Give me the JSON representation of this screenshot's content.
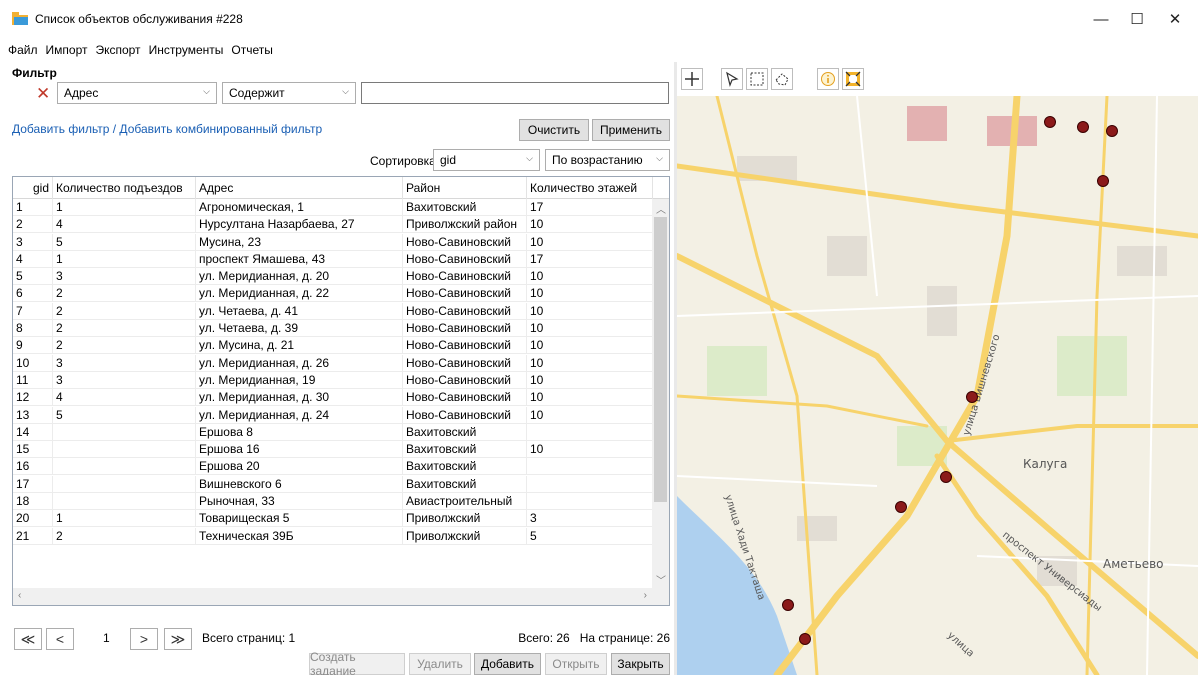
{
  "window": {
    "title": "Список объектов обслуживания #228",
    "minimize": "—",
    "maximize": "☐",
    "close": "✕"
  },
  "menu": [
    "Файл",
    "Импорт",
    "Экспорт",
    "Инструменты",
    "Отчеты"
  ],
  "filter": {
    "title": "Фильтр",
    "field": "Адрес",
    "operator": "Содержит",
    "value": "",
    "add_link": "Добавить фильтр / Добавить комбинированный фильтр",
    "clear": "Очистить",
    "apply": "Применить"
  },
  "sort": {
    "label": "Сортировка",
    "field": "gid",
    "order": "По возрастанию"
  },
  "table": {
    "columns": [
      "gid",
      "Количество подъездов",
      "Адрес",
      "Район",
      "Количество этажей"
    ],
    "rows": [
      [
        "1",
        "1",
        "Агрономическая, 1",
        "Вахитовский",
        "17"
      ],
      [
        "2",
        "4",
        "Нурсултана Назарбаева, 27",
        "Приволжский район",
        "10"
      ],
      [
        "3",
        "5",
        "Мусина, 23",
        "Ново-Савиновский",
        "10"
      ],
      [
        "4",
        "1",
        "проспект Ямашева, 43",
        "Ново-Савиновский",
        "17"
      ],
      [
        "5",
        "3",
        "ул. Меридианная, д. 20",
        "Ново-Савиновский",
        "10"
      ],
      [
        "6",
        "2",
        "ул. Меридианная, д. 22",
        "Ново-Савиновский",
        "10"
      ],
      [
        "7",
        "2",
        "ул. Четаева, д. 41",
        "Ново-Савиновский",
        "10"
      ],
      [
        "8",
        "2",
        "ул. Четаева, д. 39",
        "Ново-Савиновский",
        "10"
      ],
      [
        "9",
        "2",
        "ул. Мусина, д. 21",
        "Ново-Савиновский",
        "10"
      ],
      [
        "10",
        "3",
        "ул. Меридианная, д. 26",
        "Ново-Савиновский",
        "10"
      ],
      [
        "11",
        "3",
        "ул. Меридианная, 19",
        "Ново-Савиновский",
        "10"
      ],
      [
        "12",
        "4",
        "ул. Меридианная, д. 30",
        "Ново-Савиновский",
        "10"
      ],
      [
        "13",
        "5",
        "ул. Меридианная, д. 24",
        "Ново-Савиновский",
        "10"
      ],
      [
        "14",
        "",
        "Ершова 8",
        "Вахитовский",
        ""
      ],
      [
        "15",
        "",
        "Ершова 16",
        "Вахитовский",
        "10"
      ],
      [
        "16",
        "",
        "Ершова 20",
        "Вахитовский",
        ""
      ],
      [
        "17",
        "",
        "Вишневского 6",
        "Вахитовский",
        ""
      ],
      [
        "18",
        "",
        "Рыночная, 33",
        "Авиастроительный",
        ""
      ],
      [
        "20",
        "1",
        "Товарищеская 5",
        "Приволжский",
        "3"
      ],
      [
        "21",
        "2",
        "Техническая 39Б",
        "Приволжский",
        "5"
      ]
    ]
  },
  "pager": {
    "first": "≪",
    "prev": "<",
    "page": "1",
    "next": ">",
    "last": "≫",
    "total_pages": "Всего страниц: 1",
    "summary": "Всего: 26   На странице: 26"
  },
  "actions": {
    "create_task": "Создать задание",
    "delete": "Удалить",
    "add": "Добавить",
    "open": "Открыть",
    "close": "Закрыть"
  },
  "map": {
    "labels": {
      "kaluga": "Калуга",
      "ametyevo": "Аметьево",
      "vishnevskogo": "улица Вишневского",
      "universiady": "проспект Универсиады",
      "hadi": "улица Хади Такташа",
      "ulitsa": "улица"
    }
  }
}
